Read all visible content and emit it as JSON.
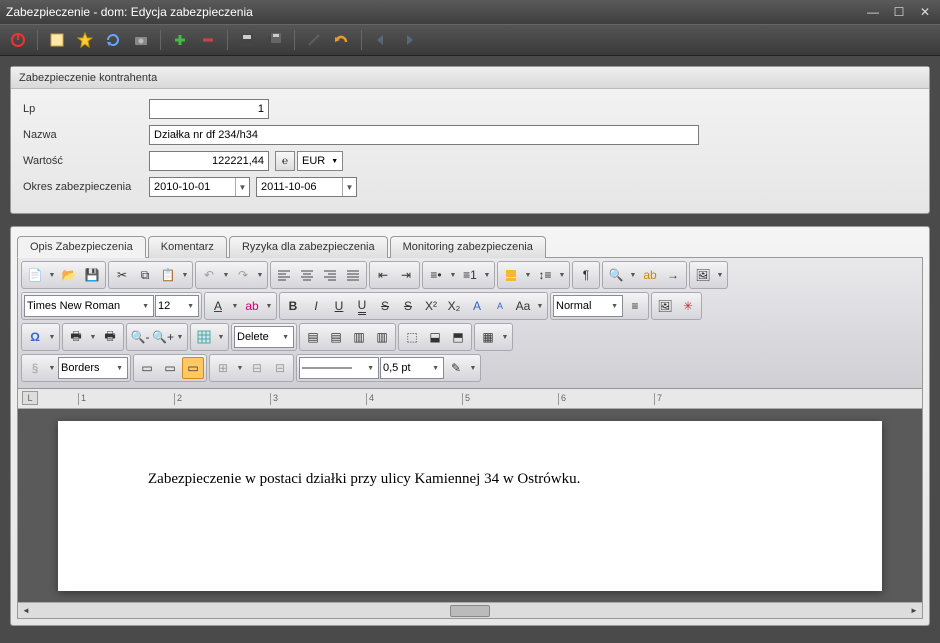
{
  "window": {
    "title": "Zabezpieczenie - dom:  Edycja zabezpieczenia"
  },
  "form": {
    "header": "Zabezpieczenie kontrahenta",
    "lp_label": "Lp",
    "lp_value": "1",
    "nazwa_label": "Nazwa",
    "nazwa_value": "Działka nr df 234/h34",
    "wartosc_label": "Wartość",
    "wartosc_value": "122221,44",
    "currency": "EUR",
    "okres_label": "Okres zabezpieczenia",
    "date_from": "2010-10-01",
    "date_to": "2011-10-06"
  },
  "tabs": {
    "t1": "Opis Zabezpieczenia",
    "t2": "Komentarz",
    "t3": "Ryzyka dla zabezpieczenia",
    "t4": "Monitoring zabezpieczenia"
  },
  "editor": {
    "font": "Times New Roman",
    "size": "12",
    "style": "Normal",
    "delete_label": "Delete",
    "borders_label": "Borders",
    "lineweight": "0,5 pt"
  },
  "document": {
    "text": "Zabezpieczenie w postaci działki przy ulicy Kamiennej 34 w Ostrówku."
  },
  "ruler": [
    "1",
    "2",
    "3",
    "4",
    "5",
    "6",
    "7"
  ]
}
